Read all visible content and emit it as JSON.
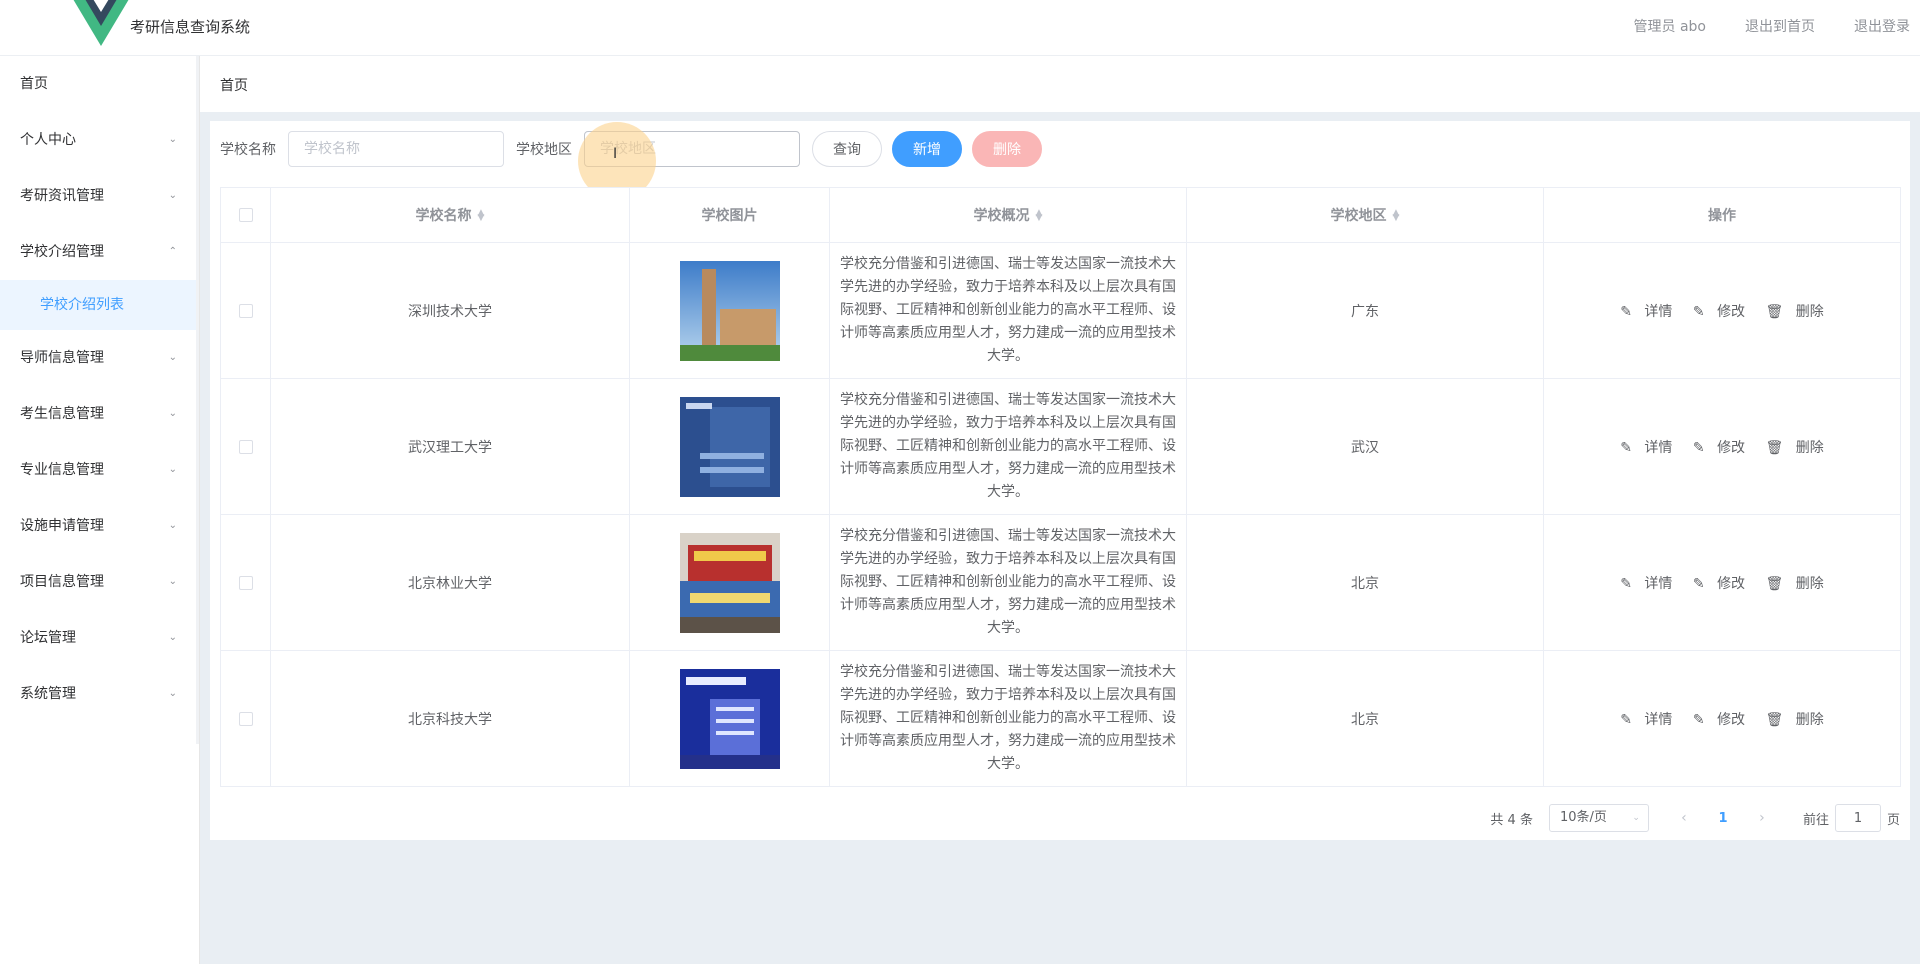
{
  "app": {
    "title": "考研信息查询系统"
  },
  "header": {
    "user": "管理员 abo",
    "back_home": "退出到首页",
    "logout": "退出登录"
  },
  "sidebar": {
    "items": [
      {
        "label": "首页",
        "chevron": ""
      },
      {
        "label": "个人中心",
        "chevron": "chevron-down"
      },
      {
        "label": "考研资讯管理",
        "chevron": "chevron-down"
      },
      {
        "label": "学校介绍管理",
        "chevron": "chevron-up"
      },
      {
        "label": "导师信息管理",
        "chevron": "chevron-down"
      },
      {
        "label": "考生信息管理",
        "chevron": "chevron-down"
      },
      {
        "label": "专业信息管理",
        "chevron": "chevron-down"
      },
      {
        "label": "设施申请管理",
        "chevron": "chevron-down"
      },
      {
        "label": "项目信息管理",
        "chevron": "chevron-down"
      },
      {
        "label": "论坛管理",
        "chevron": "chevron-down"
      },
      {
        "label": "系统管理",
        "chevron": "chevron-down"
      }
    ],
    "active_sub": "学校介绍列表"
  },
  "breadcrumb": "首页",
  "search": {
    "name_label": "学校名称",
    "name_placeholder": "学校名称",
    "region_label": "学校地区",
    "region_placeholder": "学校地区",
    "query_btn": "查询",
    "add_btn": "新增",
    "delete_btn": "删除"
  },
  "table": {
    "columns": [
      "学校名称",
      "学校图片",
      "学校概况",
      "学校地区",
      "操作"
    ],
    "ops": {
      "detail": "详情",
      "edit": "修改",
      "delete": "删除"
    },
    "rows": [
      {
        "name": "深圳技术大学",
        "image": "campus-tower-photo",
        "desc": "学校充分借鉴和引进德国、瑞士等发达国家一流技术大学先进的办学经验，致力于培养本科及以上层次具有国际视野、工匠精神和创新创业能力的高水平工程师、设计师等高素质应用型人才，努力建成一流的应用型技术大学。",
        "region": "广东"
      },
      {
        "name": "武汉理工大学",
        "image": "admission-banner-blue",
        "desc": "学校充分借鉴和引进德国、瑞士等发达国家一流技术大学先进的办学经验，致力于培养本科及以上层次具有国际视野、工匠精神和创新创业能力的高水平工程师、设计师等高素质应用型人才，努力建成一流的应用型技术大学。",
        "region": "武汉"
      },
      {
        "name": "北京林业大学",
        "image": "campus-gate-banner",
        "desc": "学校充分借鉴和引进德国、瑞士等发达国家一流技术大学先进的办学经验，致力于培养本科及以上层次具有国际视野、工匠精神和创新创业能力的高水平工程师、设计师等高素质应用型人才，努力建成一流的应用型技术大学。",
        "region": "北京"
      },
      {
        "name": "北京科技大学",
        "image": "campus-night-building",
        "desc": "学校充分借鉴和引进德国、瑞士等发达国家一流技术大学先进的办学经验，致力于培养本科及以上层次具有国际视野、工匠精神和创新创业能力的高水平工程师、设计师等高素质应用型人才，努力建成一流的应用型技术大学。",
        "region": "北京"
      }
    ]
  },
  "pagination": {
    "total": "共 4 条",
    "page_size": "10条/页",
    "current": "1",
    "goto_label": "前往",
    "goto_value": "1",
    "goto_unit": "页"
  },
  "colors": {
    "accent": "#409eff",
    "danger_light": "#fab6b6",
    "logo_green": "#41b883",
    "logo_dark": "#34495e"
  }
}
